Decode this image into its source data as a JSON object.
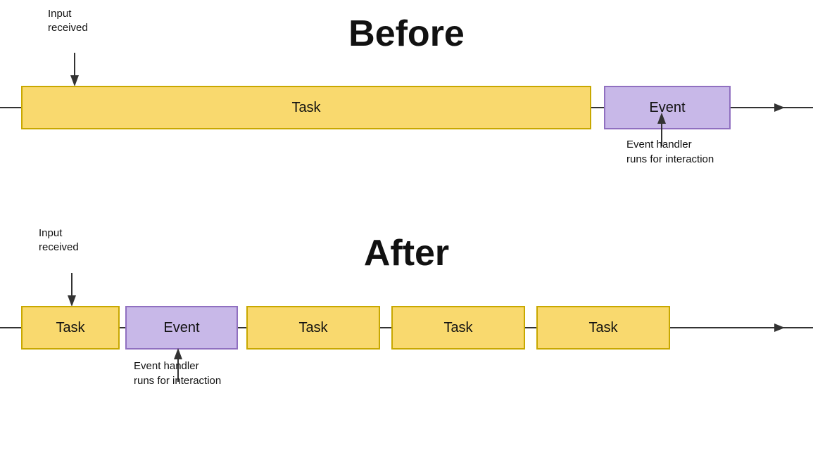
{
  "before": {
    "title": "Before",
    "input_label": "Input\nreceived",
    "task_label": "Task",
    "event_label": "Event",
    "event_handler_label": "Event handler\nruns for interaction"
  },
  "after": {
    "title": "After",
    "input_label": "Input\nreceived",
    "task_label_1": "Task",
    "event_label": "Event",
    "task_label_2": "Task",
    "task_label_3": "Task",
    "task_label_4": "Task",
    "event_handler_label": "Event handler\nruns for interaction"
  },
  "colors": {
    "task_fill": "#f9d96e",
    "task_border": "#c8a800",
    "event_fill": "#c8b8e8",
    "event_border": "#9070c0",
    "arrow": "#333333",
    "text": "#111111",
    "background": "#ffffff"
  }
}
